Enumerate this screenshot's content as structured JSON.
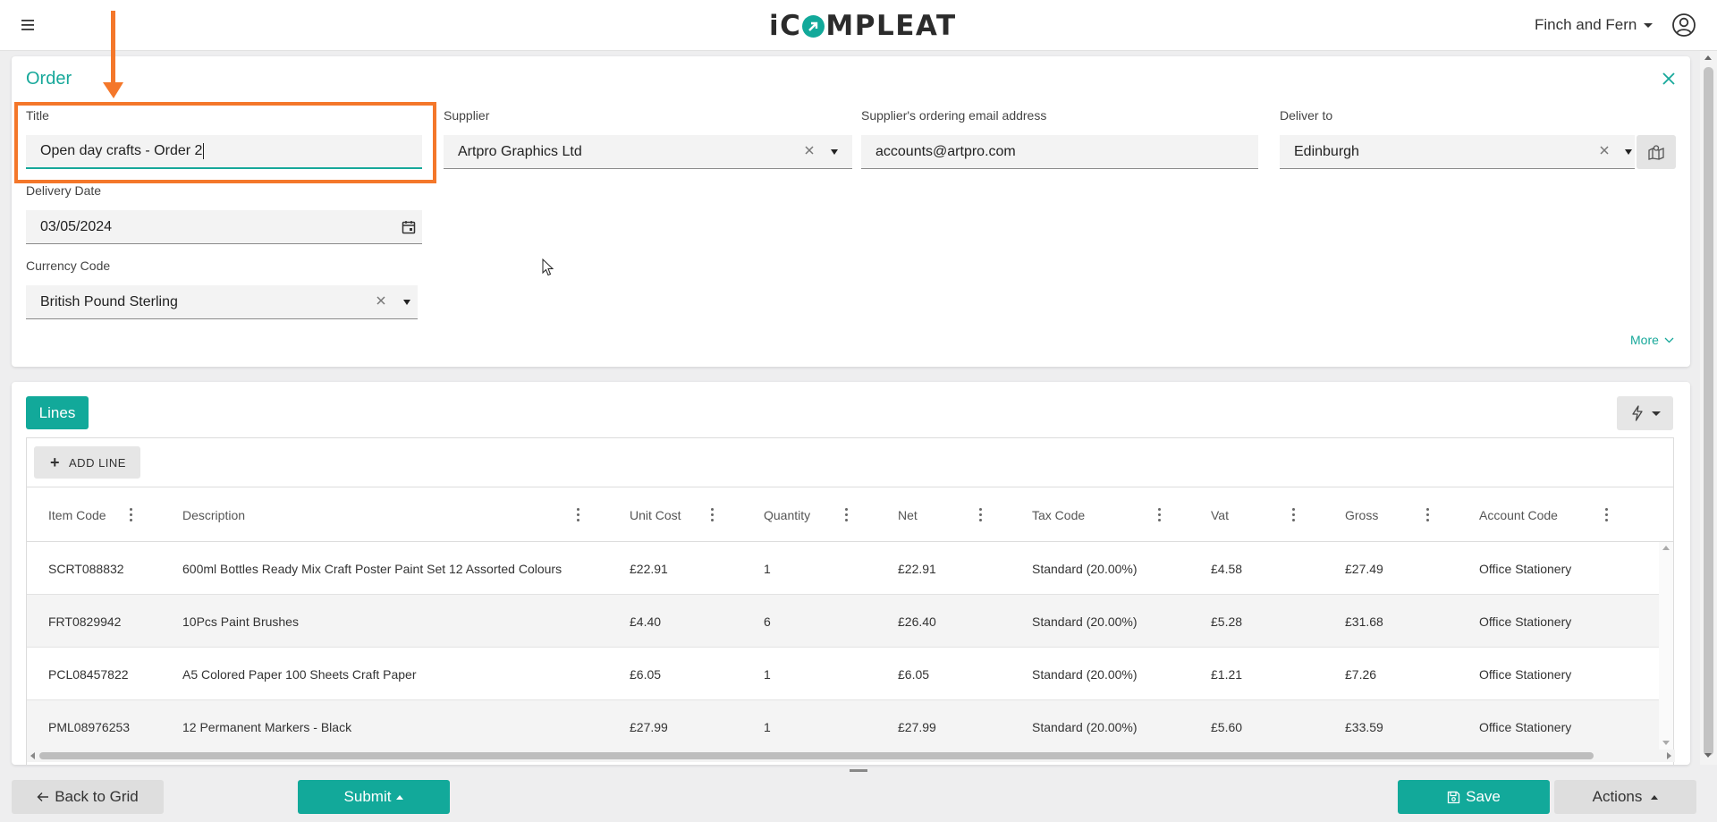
{
  "header": {
    "logo_pre": "iC",
    "logo_post": "MPLEAT",
    "org_name": "Finch and Fern"
  },
  "order": {
    "heading": "Order",
    "title_label": "Title",
    "title_value": "Open day crafts - Order 2",
    "supplier_label": "Supplier",
    "supplier_value": "Artpro Graphics Ltd",
    "email_label": "Supplier's ordering email address",
    "email_value": "accounts@artpro.com",
    "deliver_label": "Deliver to",
    "deliver_value": "Edinburgh",
    "date_label": "Delivery Date",
    "date_value": "03/05/2024",
    "currency_label": "Currency Code",
    "currency_value": "British Pound Sterling",
    "more_label": "More"
  },
  "lines": {
    "tab_label": "Lines",
    "add_line_label": "ADD LINE",
    "columns": [
      "Item Code",
      "Description",
      "Unit Cost",
      "Quantity",
      "Net",
      "Tax Code",
      "Vat",
      "Gross",
      "Account Code"
    ],
    "rows": [
      [
        "SCRT088832",
        "600ml Bottles Ready Mix Craft Poster Paint Set 12 Assorted Colours",
        "£22.91",
        "1",
        "£22.91",
        "Standard (20.00%)",
        "£4.58",
        "£27.49",
        "Office Stationery"
      ],
      [
        "FRT0829942",
        "10Pcs Paint Brushes",
        "£4.40",
        "6",
        "£26.40",
        "Standard (20.00%)",
        "£5.28",
        "£31.68",
        "Office Stationery"
      ],
      [
        "PCL08457822",
        "A5 Colored Paper 100 Sheets Craft Paper",
        "£6.05",
        "1",
        "£6.05",
        "Standard (20.00%)",
        "£1.21",
        "£7.26",
        "Office Stationery"
      ],
      [
        "PML08976253",
        "12 Permanent Markers - Black",
        "£27.99",
        "1",
        "£27.99",
        "Standard (20.00%)",
        "£5.60",
        "£33.59",
        "Office Stationery"
      ]
    ]
  },
  "footer": {
    "back_label": "Back to Grid",
    "submit_label": "Submit",
    "save_label": "Save",
    "actions_label": "Actions"
  },
  "colors": {
    "brand": "#12a99a",
    "highlight": "#f4772a"
  }
}
